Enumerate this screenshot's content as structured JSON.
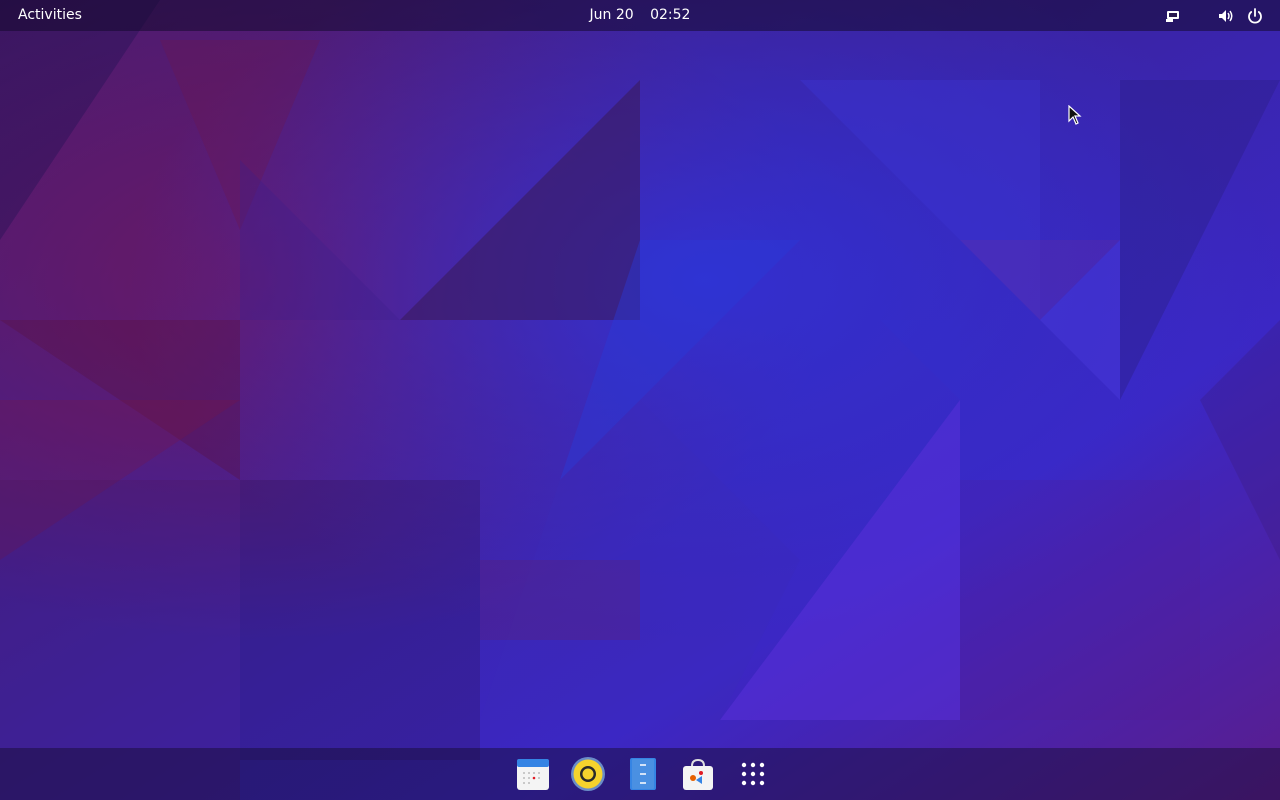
{
  "topbar": {
    "activities_label": "Activities",
    "date": "Jun 20",
    "time": "02:52",
    "tray_icons": [
      "screen-icon",
      "volume-icon",
      "power-icon"
    ]
  },
  "dock": {
    "items": [
      {
        "name": "calendar-icon"
      },
      {
        "name": "rhythmbox-icon"
      },
      {
        "name": "files-icon"
      },
      {
        "name": "software-center-icon"
      },
      {
        "name": "show-apps-grid-icon"
      }
    ]
  },
  "colors": {
    "wallpaper_base": "#3b1a82",
    "wallpaper_blue": "#2f2ed1",
    "wallpaper_magenta": "#6a1366",
    "wallpaper_violet": "#4a22b5",
    "bar_text": "#ffffff"
  }
}
